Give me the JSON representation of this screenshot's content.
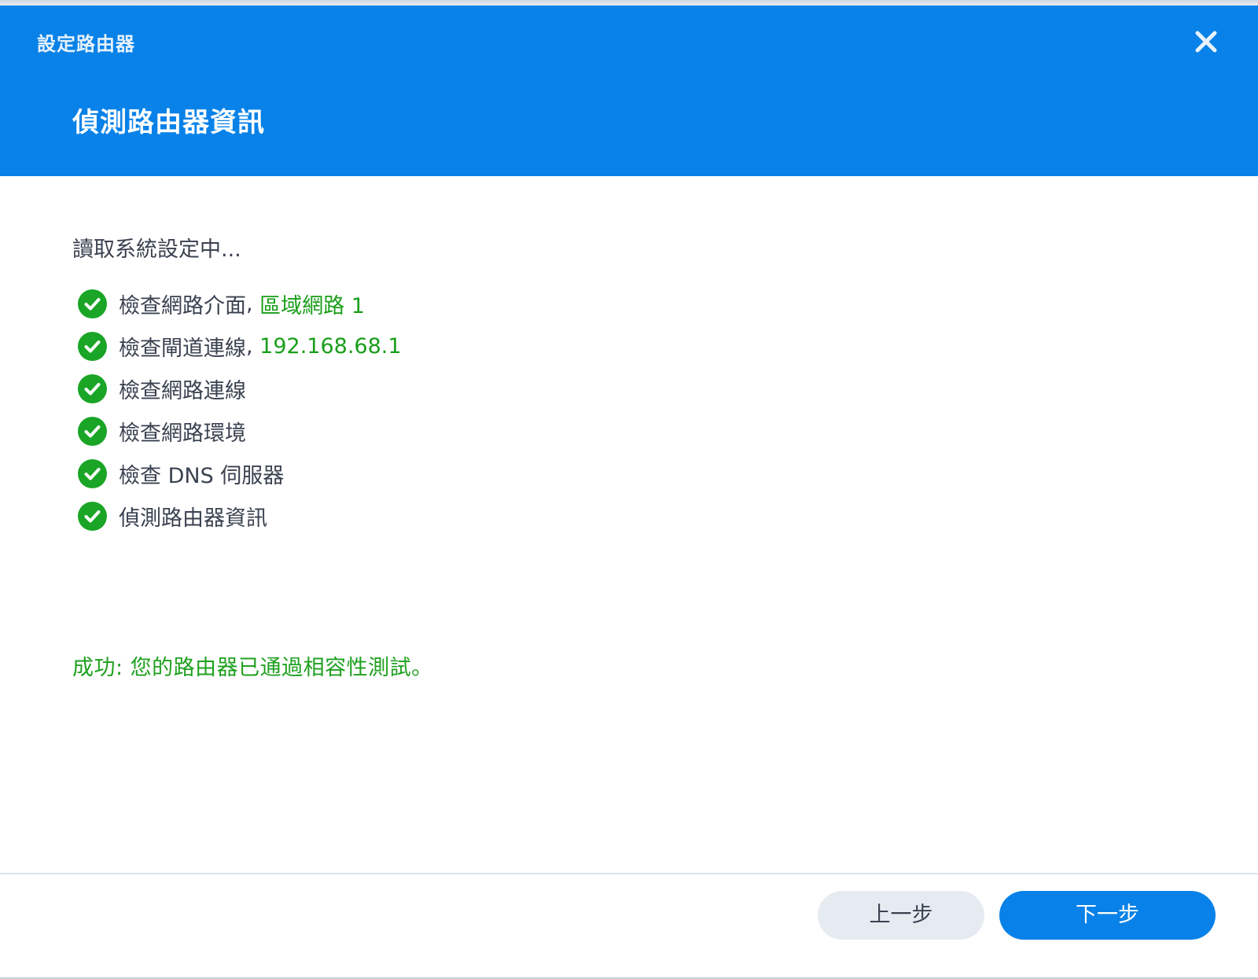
{
  "window": {
    "title": "設定路由器",
    "close_icon": "close-icon"
  },
  "step": {
    "title": "偵測路由器資訊"
  },
  "content": {
    "loading_text": "讀取系統設定中...",
    "checks": [
      {
        "label": "檢查網路介面",
        "separator": ", ",
        "value": "區域網路 1",
        "icon": "check-circle-icon"
      },
      {
        "label": "檢查閘道連線",
        "separator": ", ",
        "value": "192.168.68.1",
        "icon": "check-circle-icon"
      },
      {
        "label": "檢查網路連線",
        "separator": "",
        "value": "",
        "icon": "check-circle-icon"
      },
      {
        "label": "檢查網路環境",
        "separator": "",
        "value": "",
        "icon": "check-circle-icon"
      },
      {
        "label": "檢查 DNS 伺服器",
        "separator": "",
        "value": "",
        "icon": "check-circle-icon"
      },
      {
        "label": "偵測路由器資訊",
        "separator": "",
        "value": "",
        "icon": "check-circle-icon"
      }
    ],
    "success_message": "成功: 您的路由器已通過相容性測試。"
  },
  "footer": {
    "prev_label": "上一步",
    "next_label": "下一步"
  },
  "colors": {
    "header": "#0882e8",
    "success": "#1fa01f",
    "check": "#1aa526",
    "primary_button": "#0882e8",
    "secondary_button": "#e6ebf1"
  }
}
